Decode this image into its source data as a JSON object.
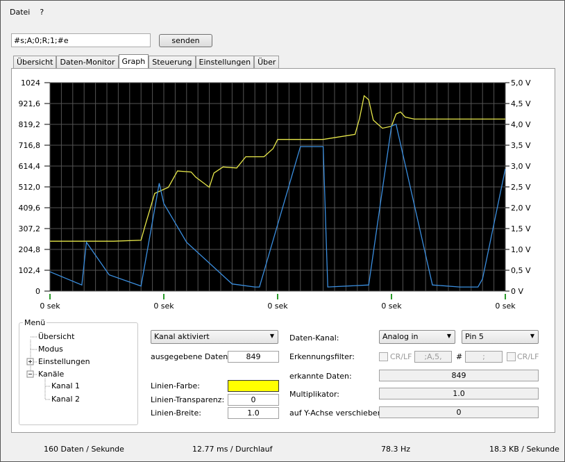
{
  "menu": [
    "Datei",
    "?"
  ],
  "command": {
    "value": "#s;A;0;R;1;#e",
    "send_label": "senden"
  },
  "tabs": [
    "Übersicht",
    "Daten-Monitor",
    "Graph",
    "Steuerung",
    "Einstellungen",
    "Über"
  ],
  "active_tab": "Graph",
  "chart_data": {
    "type": "line",
    "y_left_ticks": [
      "1024",
      "921,6",
      "819,2",
      "716,8",
      "614,4",
      "512,0",
      "409,6",
      "307,2",
      "204,8",
      "102,4",
      "0"
    ],
    "y_right_ticks": [
      "5,0 V",
      "4,5 V",
      "4,0 V",
      "3,5 V",
      "3,0 V",
      "2,5 V",
      "2,0 V",
      "1,5 V",
      "1,0 V",
      "0,5 V",
      "0 V"
    ],
    "x_ticks": [
      "0 sek",
      "0 sek",
      "0 sek",
      "0 sek",
      "0 sek"
    ],
    "ylim": [
      0,
      1024
    ],
    "grid": true,
    "series": [
      {
        "color": "#e8e84a",
        "x": [
          0,
          9,
          14,
          20,
          21,
          23,
          26,
          28,
          31,
          32,
          35,
          36,
          38,
          41,
          43,
          47,
          49,
          50,
          53,
          55,
          60,
          67,
          68,
          69,
          70,
          71,
          73,
          75,
          76,
          77,
          78,
          80,
          84,
          90,
          100
        ],
        "values": [
          245,
          245,
          245,
          250,
          330,
          480,
          510,
          590,
          585,
          560,
          510,
          580,
          610,
          605,
          660,
          660,
          700,
          745,
          745,
          745,
          745,
          770,
          850,
          960,
          940,
          840,
          800,
          810,
          870,
          880,
          855,
          845,
          845,
          845,
          845
        ]
      },
      {
        "color": "#3b8fe0",
        "x": [
          0,
          7,
          8,
          13,
          20,
          24,
          25,
          30,
          40,
          45,
          46,
          55,
          60,
          61,
          70,
          75,
          76,
          84,
          90,
          94,
          95,
          100
        ],
        "values": [
          95,
          30,
          240,
          80,
          25,
          530,
          430,
          240,
          35,
          20,
          20,
          710,
          710,
          20,
          30,
          810,
          820,
          30,
          20,
          20,
          60,
          600
        ]
      }
    ]
  },
  "sidebar": {
    "title": "Menü",
    "items": [
      "Übersicht",
      "Modus",
      "Einstellungen",
      "Kanäle",
      "Kanal 1",
      "Kanal 2"
    ],
    "selected": "Kanal 2"
  },
  "channel": {
    "status_select": "Kanal aktiviert",
    "output_label": "ausgegebene Daten:",
    "output_value": "849",
    "color_label": "Linien-Farbe:",
    "color": "#ffff00",
    "transparency_label": "Linien-Transparenz:",
    "transparency_value": "0",
    "width_label": "Linien-Breite:",
    "width_value": "1.0",
    "data_channel_label": "Daten-Kanal:",
    "data_channel_select": "Analog in",
    "pin_select": "Pin 5",
    "filter_label": "Erkennungsfilter:",
    "crlf_label": "CR/LF",
    "filter_value": ";A,5,",
    "hash_label": "#",
    "filter_end_value": ";",
    "crlf_label2": "CR/LF",
    "detected_label": "erkannte Daten:",
    "detected_value": "849",
    "multiplier_label": "Multiplikator:",
    "multiplier_value": "1.0",
    "shift_label": "auf Y-Achse verschieben:",
    "shift_value": "0"
  },
  "status": {
    "rate": "160 Daten / Sekunde",
    "cycle": "12.77 ms / Durchlauf",
    "freq": "78.3 Hz",
    "throughput": "18.3 KB / Sekunde"
  }
}
